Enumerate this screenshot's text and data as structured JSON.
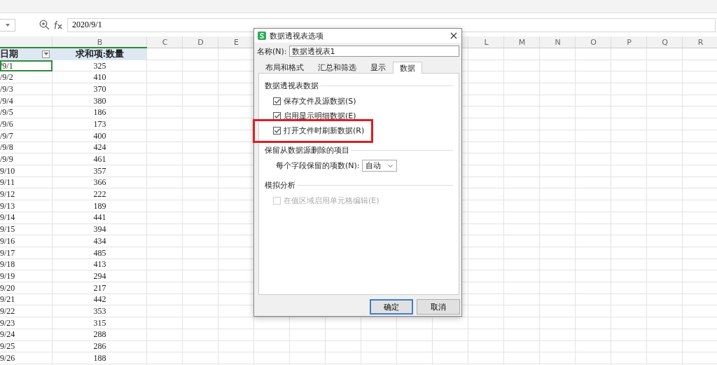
{
  "formula_bar": {
    "value": "2020/9/1"
  },
  "sheet": {
    "column_letters_left": [
      "B",
      "C",
      "D",
      "E"
    ],
    "column_letters_right": [
      "L",
      "M",
      "N",
      "O",
      "P",
      "Q",
      "R"
    ],
    "headers": [
      "日期",
      "求和项:数量"
    ],
    "rows": [
      {
        "date": "/9/1",
        "quantity": "325",
        "selected": true
      },
      {
        "date": "/9/2",
        "quantity": "410",
        "selected": false
      },
      {
        "date": "/9/3",
        "quantity": "370",
        "selected": false
      },
      {
        "date": "/9/4",
        "quantity": "380",
        "selected": false
      },
      {
        "date": "/9/5",
        "quantity": "186",
        "selected": false
      },
      {
        "date": "/9/6",
        "quantity": "173",
        "selected": false
      },
      {
        "date": "/9/7",
        "quantity": "400",
        "selected": false
      },
      {
        "date": "/9/8",
        "quantity": "424",
        "selected": false
      },
      {
        "date": "/9/9",
        "quantity": "461",
        "selected": false
      },
      {
        "date": "9/10",
        "quantity": "357",
        "selected": false
      },
      {
        "date": "9/11",
        "quantity": "366",
        "selected": false
      },
      {
        "date": "9/12",
        "quantity": "222",
        "selected": false
      },
      {
        "date": "9/13",
        "quantity": "189",
        "selected": false
      },
      {
        "date": "9/14",
        "quantity": "441",
        "selected": false
      },
      {
        "date": "9/15",
        "quantity": "394",
        "selected": false
      },
      {
        "date": "9/16",
        "quantity": "434",
        "selected": false
      },
      {
        "date": "9/17",
        "quantity": "485",
        "selected": false
      },
      {
        "date": "9/18",
        "quantity": "413",
        "selected": false
      },
      {
        "date": "9/19",
        "quantity": "294",
        "selected": false
      },
      {
        "date": "9/20",
        "quantity": "217",
        "selected": false
      },
      {
        "date": "9/21",
        "quantity": "442",
        "selected": false
      },
      {
        "date": "9/22",
        "quantity": "353",
        "selected": false
      },
      {
        "date": "9/23",
        "quantity": "315",
        "selected": false
      },
      {
        "date": "9/24",
        "quantity": "288",
        "selected": false
      },
      {
        "date": "9/25",
        "quantity": "286",
        "selected": false
      },
      {
        "date": "9/26",
        "quantity": "188",
        "selected": false
      }
    ]
  },
  "dialog": {
    "title": "数据透视表选项",
    "name_label": "名称(N):",
    "name_value": "数据透视表1",
    "tabs": [
      {
        "label": "布局和格式",
        "selected": false
      },
      {
        "label": "汇总和筛选",
        "selected": false
      },
      {
        "label": "显示",
        "selected": false
      },
      {
        "label": "数据",
        "selected": true
      }
    ],
    "sections": [
      {
        "title": "数据透视表数据",
        "items": [
          {
            "kind": "checkbox",
            "label": "保存文件及源数据(S)",
            "checked": true,
            "disabled": false,
            "highlighted": false
          },
          {
            "kind": "checkbox",
            "label": "启用显示明细数据(E)",
            "checked": true,
            "disabled": false,
            "highlighted": false
          },
          {
            "kind": "checkbox",
            "label": "打开文件时刷新数据(R)",
            "checked": true,
            "disabled": false,
            "highlighted": true
          }
        ]
      },
      {
        "title": "保留从数据源删除的项目",
        "items": [
          {
            "kind": "select",
            "label": "每个字段保留的项数(N):",
            "value": "自动"
          }
        ]
      },
      {
        "title": "模拟分析",
        "items": [
          {
            "kind": "checkbox",
            "label": "在值区域启用单元格编辑(E)",
            "checked": false,
            "disabled": true,
            "highlighted": false
          }
        ]
      }
    ],
    "buttons": [
      {
        "label": "确定",
        "default": true
      },
      {
        "label": "取消",
        "default": false
      }
    ]
  }
}
